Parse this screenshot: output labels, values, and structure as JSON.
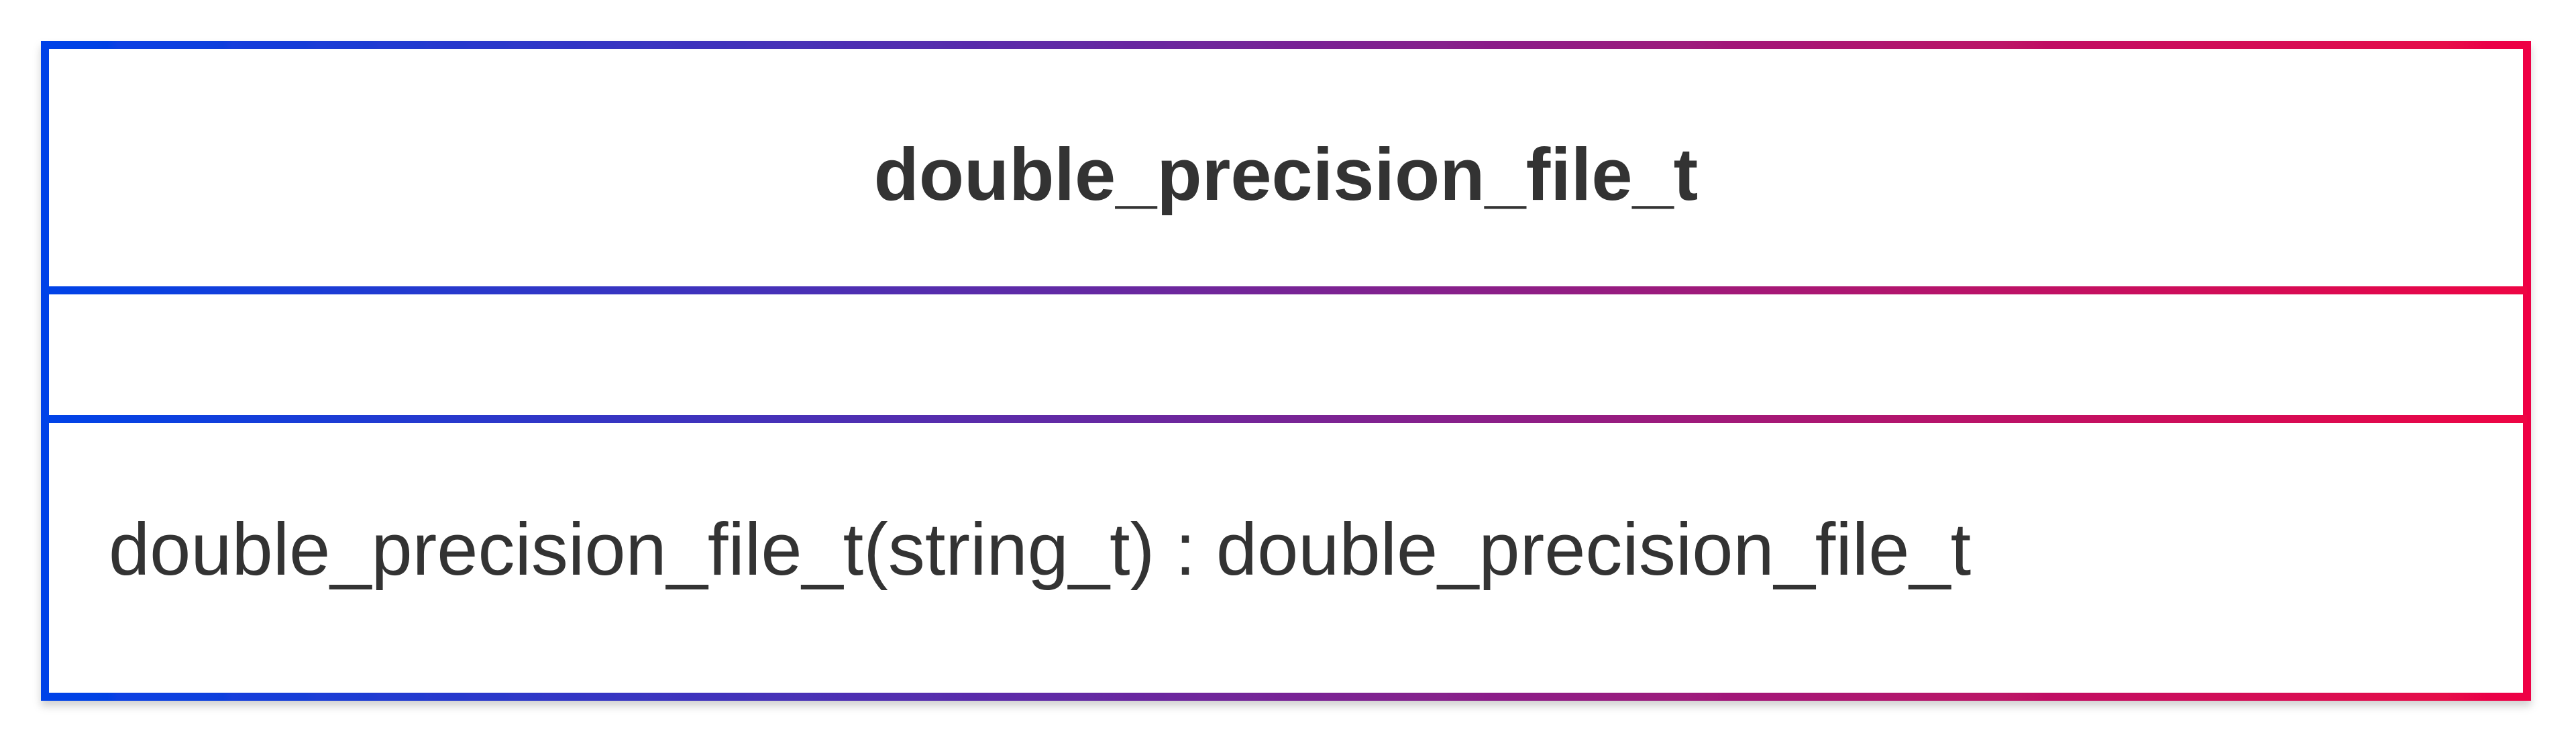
{
  "uml_class": {
    "name": "double_precision_file_t",
    "attributes": [],
    "methods": [
      "double_precision_file_t(string_t) : double_precision_file_t"
    ]
  },
  "colors": {
    "border_gradient_start": "#0043e8",
    "border_gradient_end": "#ee0544",
    "text": "#333333",
    "background": "#ffffff"
  }
}
